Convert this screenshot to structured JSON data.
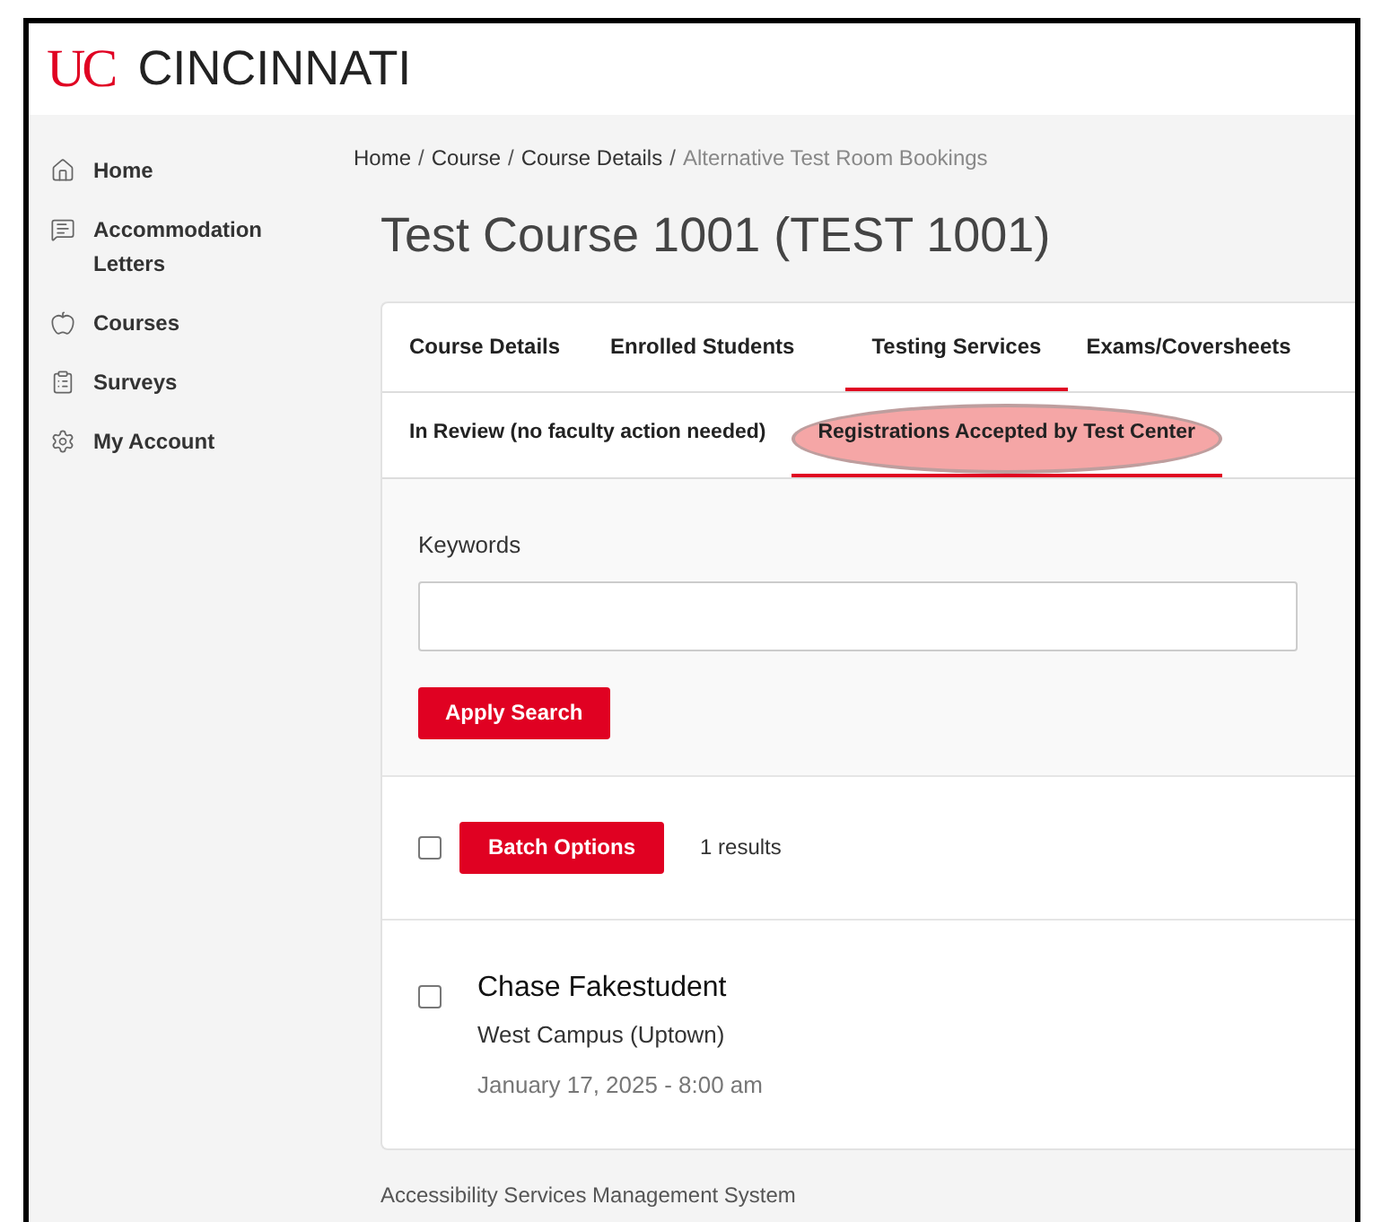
{
  "header": {
    "logo_mark": "UC",
    "logo_text": "CINCINNATI"
  },
  "sidebar": {
    "items": [
      {
        "label": "Home"
      },
      {
        "label": "Accommodation Letters"
      },
      {
        "label": "Courses"
      },
      {
        "label": "Surveys"
      },
      {
        "label": "My Account"
      }
    ]
  },
  "breadcrumb": [
    {
      "label": "Home",
      "current": false
    },
    {
      "label": "Course",
      "current": false
    },
    {
      "label": "Course Details",
      "current": false
    },
    {
      "label": "Alternative Test Room Bookings",
      "current": true
    }
  ],
  "breadcrumb_separator": "/",
  "page_title": "Test Course 1001 (TEST 1001)",
  "tabs": [
    {
      "label": "Course Details",
      "selected": false
    },
    {
      "label": "Enrolled Students",
      "selected": false
    },
    {
      "label": "Testing Services",
      "selected": true
    },
    {
      "label": "Exams/Coversheets",
      "selected": false
    }
  ],
  "subtabs": [
    {
      "label": "In Review (no faculty action needed)",
      "selected": false,
      "highlighted": false
    },
    {
      "label": "Registrations Accepted by Test Center",
      "selected": true,
      "highlighted": true
    }
  ],
  "search": {
    "label": "Keywords",
    "button": "Apply Search"
  },
  "batch": {
    "checked": false,
    "button": "Batch Options",
    "results": "1 results"
  },
  "results": [
    {
      "name": "Chase Fakestudent",
      "campus": "West Campus (Uptown)",
      "date": "January 17, 2025 - 8:00 am",
      "checked": false
    }
  ],
  "footer": "Accessibility Services Management System"
}
